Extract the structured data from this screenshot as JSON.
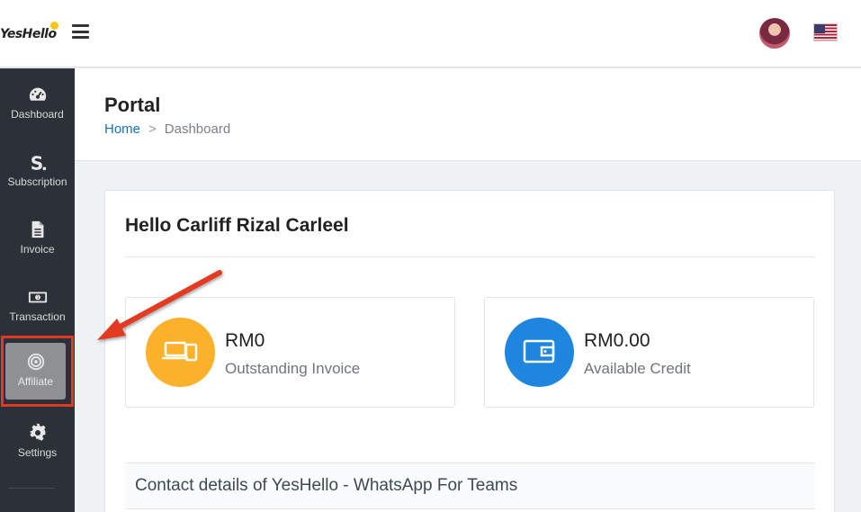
{
  "header": {
    "logo_text": "YesHello",
    "menu_icon": "hamburger-icon",
    "avatar_icon": "user-avatar",
    "language_icon": "us-flag-icon"
  },
  "sidebar": {
    "items": [
      {
        "label": "Dashboard",
        "icon": "speedometer-icon"
      },
      {
        "label": "Subscription",
        "icon": "subscription-s-icon"
      },
      {
        "label": "Invoice",
        "icon": "document-icon"
      },
      {
        "label": "Transaction",
        "icon": "banknote-icon"
      },
      {
        "label": "Affiliate",
        "icon": "target-icon",
        "active": true
      },
      {
        "label": "Settings",
        "icon": "gear-icon"
      }
    ]
  },
  "page": {
    "title": "Portal",
    "breadcrumb": {
      "home": "Home",
      "current": "Dashboard"
    }
  },
  "main": {
    "greeting": "Hello Carliff Rizal Carleel",
    "stats": [
      {
        "value": "RM0",
        "label": "Outstanding Invoice",
        "icon": "devices-icon",
        "color": "#fbb12a"
      },
      {
        "value": "RM0.00",
        "label": "Available Credit",
        "icon": "wallet-icon",
        "color": "#1f86e0"
      }
    ],
    "contact_title": "Contact details of YesHello - WhatsApp For Teams"
  },
  "annotation": {
    "highlight_color": "#e23a22",
    "arrow_color": "#e23a22"
  }
}
